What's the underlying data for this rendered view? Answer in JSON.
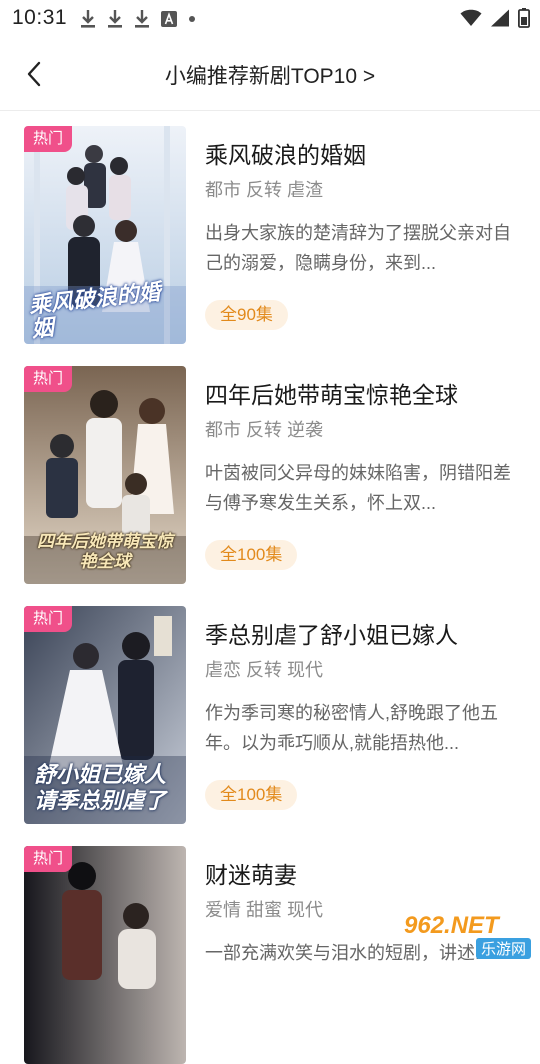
{
  "status_bar": {
    "time": "10:31",
    "left_icons": [
      "download-icon",
      "download-icon",
      "download-icon",
      "text-a-icon",
      "dot-icon"
    ],
    "right_icons": [
      "wifi-icon",
      "signal-icon",
      "battery-icon"
    ]
  },
  "header": {
    "back_icon": "chevron-left-icon",
    "title": "小编推荐新剧TOP10 >"
  },
  "dramas": [
    {
      "badge": "热门",
      "title": "乘风破浪的婚姻",
      "tags": [
        "都市",
        "反转",
        "虐渣"
      ],
      "description": "出身大家族的楚清辞为了摆脱父亲对自己的溺爱，隐瞒身份，来到...",
      "episodes": "全90集",
      "poster_text": "乘风破浪的婚姻",
      "poster_colors": [
        "#c9d9ea",
        "#eef2f8"
      ]
    },
    {
      "badge": "热门",
      "title": "四年后她带萌宝惊艳全球",
      "tags": [
        "都市",
        "反转",
        "逆袭"
      ],
      "description": "叶茵被同父异母的妹妹陷害，阴错阳差与傅予寒发生关系，怀上双...",
      "episodes": "全100集",
      "poster_text": "四年后她带萌宝惊艳全球",
      "poster_colors": [
        "#5a4a3c",
        "#d8c7b0"
      ]
    },
    {
      "badge": "热门",
      "title": "季总别虐了舒小姐已嫁人",
      "tags": [
        "虐恋",
        "反转",
        "现代"
      ],
      "description": "作为季司寒的秘密情人,舒晚跟了他五年。以为乖巧顺从,就能捂热他...",
      "episodes": "全100集",
      "poster_text": "舒小姐已嫁人 请季总别虐了",
      "poster_colors": [
        "#2b3546",
        "#d9dde6"
      ]
    },
    {
      "badge": "热门",
      "title": "财迷萌妻",
      "tags": [
        "爱情",
        "甜蜜",
        "现代"
      ],
      "description": "一部充满欢笑与泪水的短剧，讲述...",
      "episodes": "",
      "poster_text": "",
      "poster_colors": [
        "#1e1e26",
        "#b9b2ad"
      ]
    }
  ],
  "watermark": {
    "brand": "962.NET",
    "sub": "乐游网"
  }
}
